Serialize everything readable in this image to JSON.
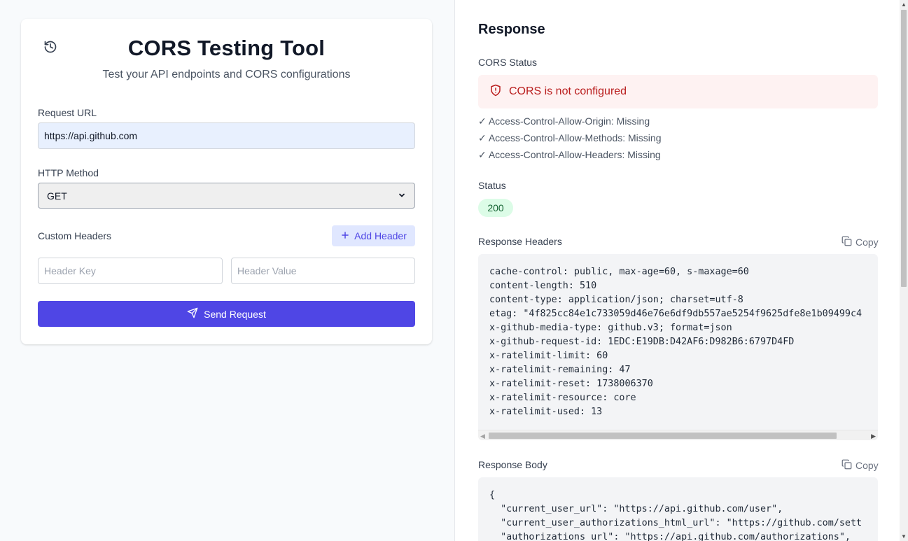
{
  "form": {
    "title": "CORS Testing Tool",
    "subtitle": "Test your API endpoints and CORS configurations",
    "url_label": "Request URL",
    "url_value": "https://api.github.com",
    "method_label": "HTTP Method",
    "method_value": "GET",
    "custom_headers_label": "Custom Headers",
    "add_header_label": "Add Header",
    "header_key_placeholder": "Header Key",
    "header_value_placeholder": "Header Value",
    "send_label": "Send Request"
  },
  "response": {
    "title": "Response",
    "cors_status_label": "CORS Status",
    "cors_status_message": "CORS is not configured",
    "checks": [
      "✓ Access-Control-Allow-Origin: Missing",
      "✓ Access-Control-Allow-Methods: Missing",
      "✓ Access-Control-Allow-Headers: Missing"
    ],
    "status_label": "Status",
    "status_code": "200",
    "headers_label": "Response Headers",
    "copy_label": "Copy",
    "headers_text": "cache-control: public, max-age=60, s-maxage=60\ncontent-length: 510\ncontent-type: application/json; charset=utf-8\netag: \"4f825cc84e1c733059d46e76e6df9db557ae5254f9625dfe8e1b09499c4\nx-github-media-type: github.v3; format=json\nx-github-request-id: 1EDC:E19DB:D42AF6:D982B6:6797D4FD\nx-ratelimit-limit: 60\nx-ratelimit-remaining: 47\nx-ratelimit-reset: 1738006370\nx-ratelimit-resource: core\nx-ratelimit-used: 13",
    "body_label": "Response Body",
    "body_text": "{\n  \"current_user_url\": \"https://api.github.com/user\",\n  \"current_user_authorizations_html_url\": \"https://github.com/sett\n  \"authorizations_url\": \"https://api.github.com/authorizations\","
  },
  "colors": {
    "accent": "#4f46e5",
    "error_bg": "#fef2f2",
    "error_text": "#b91c1c",
    "success_bg": "#dcfce7",
    "success_text": "#166534"
  },
  "icons": {
    "history": "history-icon",
    "plus": "plus-icon",
    "send": "send-icon",
    "shield_alert": "shield-alert-icon",
    "copy": "copy-icon",
    "chevron_down": "chevron-down-icon"
  }
}
